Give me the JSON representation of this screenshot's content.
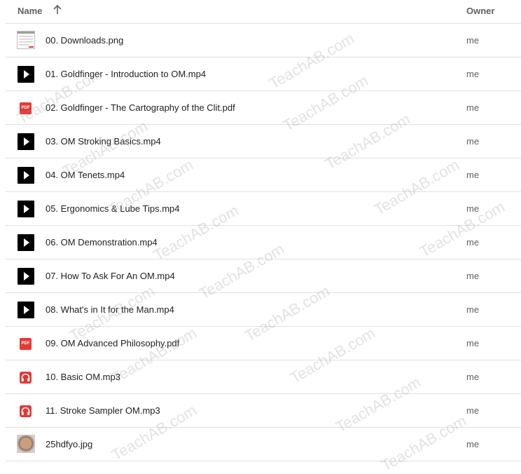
{
  "header": {
    "name_label": "Name",
    "owner_label": "Owner"
  },
  "files": [
    {
      "name": "00. Downloads.png",
      "owner": "me",
      "type": "image-png"
    },
    {
      "name": "01. Goldfinger - Introduction to OM.mp4",
      "owner": "me",
      "type": "video"
    },
    {
      "name": "02. Goldfinger - The Cartography of the Clit.pdf",
      "owner": "me",
      "type": "pdf"
    },
    {
      "name": "03. OM Stroking Basics.mp4",
      "owner": "me",
      "type": "video"
    },
    {
      "name": "04. OM Tenets.mp4",
      "owner": "me",
      "type": "video"
    },
    {
      "name": "05. Ergonomics & Lube Tips.mp4",
      "owner": "me",
      "type": "video"
    },
    {
      "name": "06. OM Demonstration.mp4",
      "owner": "me",
      "type": "video"
    },
    {
      "name": "07. How To Ask For An OM.mp4",
      "owner": "me",
      "type": "video"
    },
    {
      "name": "08. What's in It for the Man.mp4",
      "owner": "me",
      "type": "video"
    },
    {
      "name": "09. OM Advanced Philosophy.pdf",
      "owner": "me",
      "type": "pdf"
    },
    {
      "name": "10. Basic OM.mp3",
      "owner": "me",
      "type": "audio"
    },
    {
      "name": "11. Stroke Sampler OM.mp3",
      "owner": "me",
      "type": "audio"
    },
    {
      "name": "25hdfyo.jpg",
      "owner": "me",
      "type": "image-jpg"
    }
  ],
  "icons": {
    "pdf_text": "PDF",
    "sort": "arrow-up-icon"
  },
  "watermark": "TeachAB.com",
  "colors": {
    "pdf": "#e53935",
    "audio": "#e53935",
    "video": "#000000",
    "divider": "#e0e0e0"
  }
}
